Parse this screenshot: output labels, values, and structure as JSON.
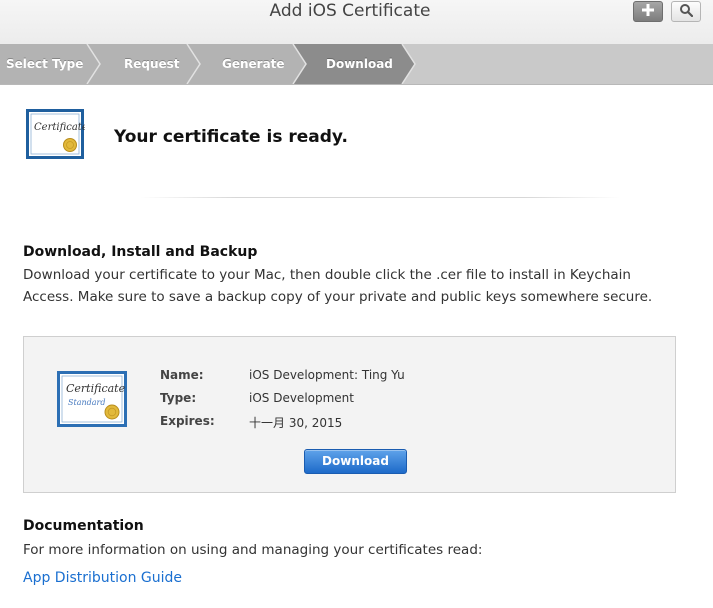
{
  "header": {
    "title": "Add iOS Certificate",
    "add_icon": "plus-icon",
    "search_icon": "search-icon"
  },
  "steps": [
    "Select Type",
    "Request",
    "Generate",
    "Download"
  ],
  "status": {
    "message": "Your certificate is ready."
  },
  "download_section": {
    "heading": "Download, Install and Backup",
    "line1": "Download your certificate to your Mac, then double click the .cer file to install in Keychain",
    "line2": "Access. Make sure to save a backup copy of your private and public keys somewhere secure."
  },
  "certificate": {
    "icon_title": "Certificate",
    "icon_subtitle": "Standard",
    "name_label": "Name:",
    "name_value": "iOS Development: Ting Yu",
    "type_label": "Type:",
    "type_value": "iOS Development",
    "expires_label": "Expires:",
    "expires_value": "十一月 30, 2015",
    "download_label": "Download"
  },
  "documentation": {
    "heading": "Documentation",
    "text": "For more information on using and managing your certificates read:",
    "link": "App Distribution Guide"
  },
  "colors": {
    "link": "#1a6fd0",
    "button": "#2a78d6",
    "active_step": "#8c8c8c",
    "step_bar": "#c9c9c9"
  }
}
